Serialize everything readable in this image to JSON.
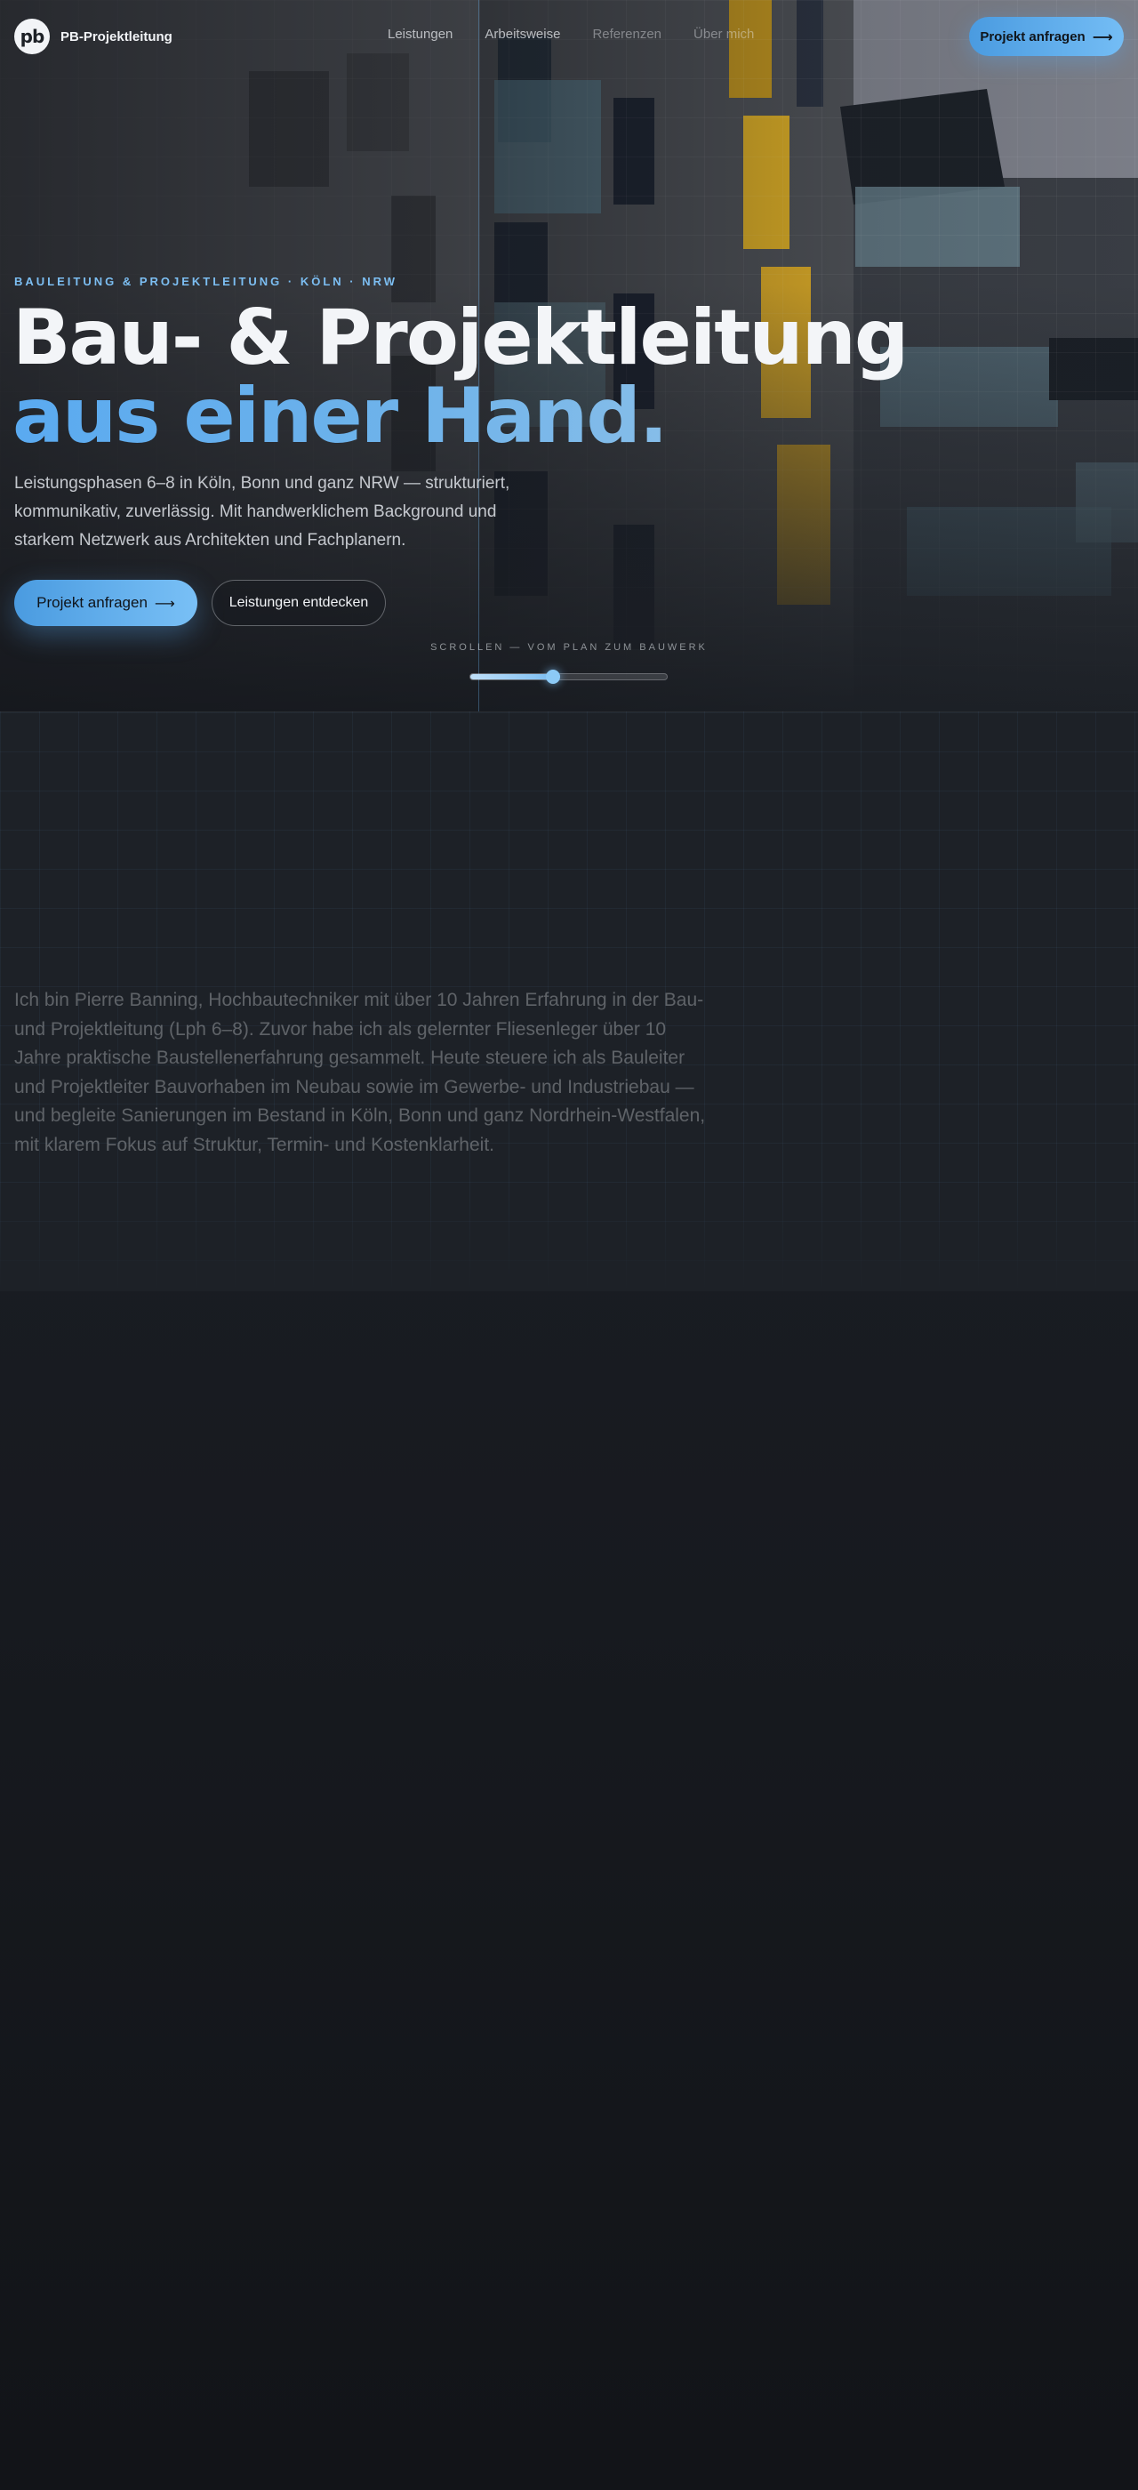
{
  "nav": {
    "brand_logo": "pb",
    "brand_name": "PB-Projektleitung",
    "links": [
      "Leistungen",
      "Arbeitsweise",
      "Referenzen",
      "Über mich"
    ],
    "cta_label": "Projekt anfragen",
    "cta_icon": "arrow-right-icon"
  },
  "hero": {
    "eyebrow": "BAULEITUNG & PROJEKTLEITUNG · KÖLN · NRW",
    "headline_line1": "Bau- & Projektleitung",
    "headline_line2": "aus einer Hand.",
    "subtitle": "Leistungsphasen 6–8 in Köln, Bonn und ganz NRW — strukturiert, kommunikativ, zuverlässig. Mit handwerklichem Background und starkem Netzwerk aus Architekten und Fachplanern.",
    "primary_button": "Projekt anfragen",
    "secondary_button": "Leistungen entdecken",
    "scroll_hint": "SCROLLEN — VOM PLAN ZUM BAUWERK",
    "scroll_progress": 0.42
  },
  "about": {
    "text": "Ich bin Pierre Banning, Hochbautechniker mit über 10 Jahren Erfahrung in der Bau- und Projektleitung (Lph 6–8). Zuvor habe ich als gelernter Fliesenleger über 10 Jahre praktische Baustellenerfahrung gesammelt. Heute steuere ich als Bauleiter und Projektleiter Bauvorhaben im Neubau sowie im Gewerbe- und Industriebau — und begleite Sanierungen im Bestand in Köln, Bonn und ganz Nordrhein-Westfalen, mit klarem Fokus auf Struktur, Termin- und Kostenklarheit."
  },
  "colors": {
    "accent": "#5aaaf0",
    "accent_light": "#79c0f6",
    "background": "#1d2127",
    "text": "#f3f5f8"
  }
}
